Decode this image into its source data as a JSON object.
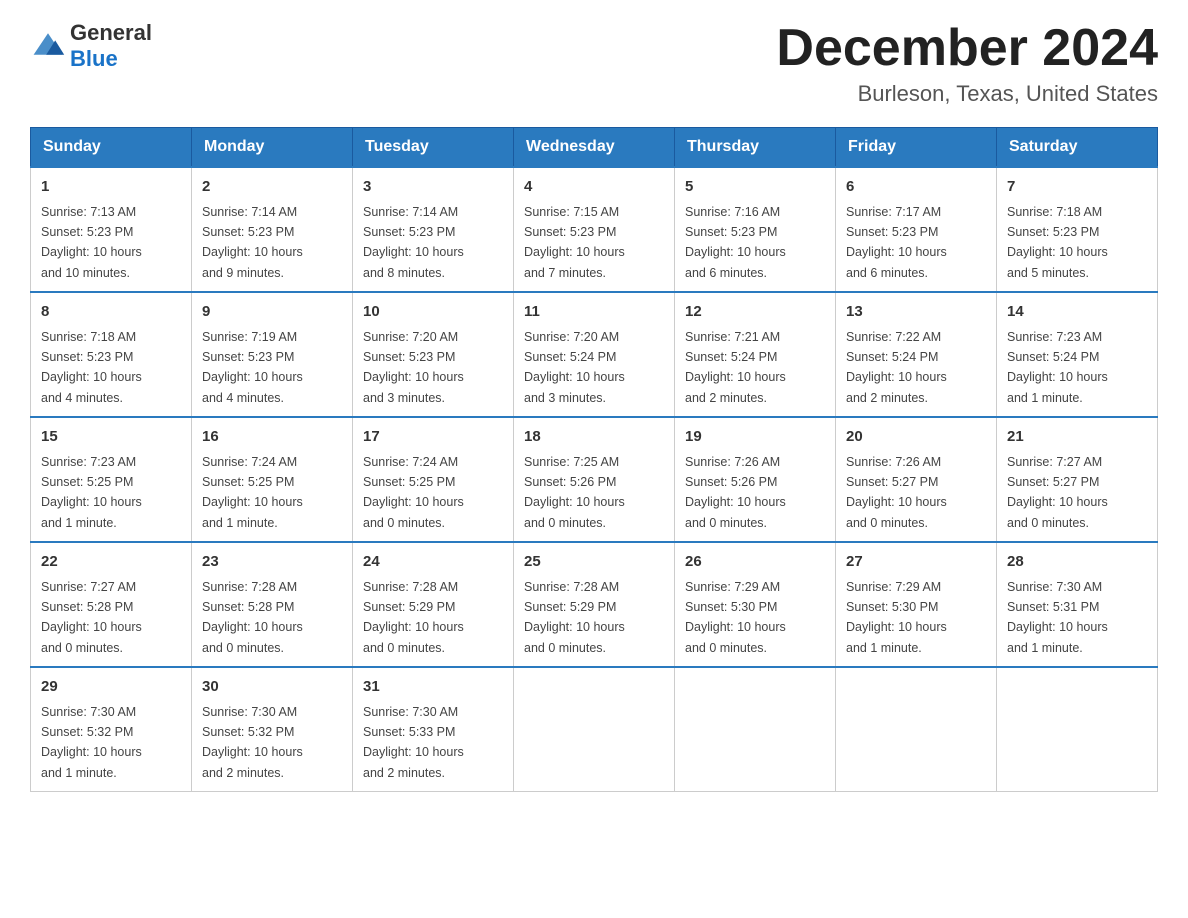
{
  "header": {
    "logo_general": "General",
    "logo_blue": "Blue",
    "month_title": "December 2024",
    "location": "Burleson, Texas, United States"
  },
  "days_of_week": [
    "Sunday",
    "Monday",
    "Tuesday",
    "Wednesday",
    "Thursday",
    "Friday",
    "Saturday"
  ],
  "weeks": [
    [
      {
        "day": "1",
        "sunrise": "7:13 AM",
        "sunset": "5:23 PM",
        "daylight": "10 hours and 10 minutes."
      },
      {
        "day": "2",
        "sunrise": "7:14 AM",
        "sunset": "5:23 PM",
        "daylight": "10 hours and 9 minutes."
      },
      {
        "day": "3",
        "sunrise": "7:14 AM",
        "sunset": "5:23 PM",
        "daylight": "10 hours and 8 minutes."
      },
      {
        "day": "4",
        "sunrise": "7:15 AM",
        "sunset": "5:23 PM",
        "daylight": "10 hours and 7 minutes."
      },
      {
        "day": "5",
        "sunrise": "7:16 AM",
        "sunset": "5:23 PM",
        "daylight": "10 hours and 6 minutes."
      },
      {
        "day": "6",
        "sunrise": "7:17 AM",
        "sunset": "5:23 PM",
        "daylight": "10 hours and 6 minutes."
      },
      {
        "day": "7",
        "sunrise": "7:18 AM",
        "sunset": "5:23 PM",
        "daylight": "10 hours and 5 minutes."
      }
    ],
    [
      {
        "day": "8",
        "sunrise": "7:18 AM",
        "sunset": "5:23 PM",
        "daylight": "10 hours and 4 minutes."
      },
      {
        "day": "9",
        "sunrise": "7:19 AM",
        "sunset": "5:23 PM",
        "daylight": "10 hours and 4 minutes."
      },
      {
        "day": "10",
        "sunrise": "7:20 AM",
        "sunset": "5:23 PM",
        "daylight": "10 hours and 3 minutes."
      },
      {
        "day": "11",
        "sunrise": "7:20 AM",
        "sunset": "5:24 PM",
        "daylight": "10 hours and 3 minutes."
      },
      {
        "day": "12",
        "sunrise": "7:21 AM",
        "sunset": "5:24 PM",
        "daylight": "10 hours and 2 minutes."
      },
      {
        "day": "13",
        "sunrise": "7:22 AM",
        "sunset": "5:24 PM",
        "daylight": "10 hours and 2 minutes."
      },
      {
        "day": "14",
        "sunrise": "7:23 AM",
        "sunset": "5:24 PM",
        "daylight": "10 hours and 1 minute."
      }
    ],
    [
      {
        "day": "15",
        "sunrise": "7:23 AM",
        "sunset": "5:25 PM",
        "daylight": "10 hours and 1 minute."
      },
      {
        "day": "16",
        "sunrise": "7:24 AM",
        "sunset": "5:25 PM",
        "daylight": "10 hours and 1 minute."
      },
      {
        "day": "17",
        "sunrise": "7:24 AM",
        "sunset": "5:25 PM",
        "daylight": "10 hours and 0 minutes."
      },
      {
        "day": "18",
        "sunrise": "7:25 AM",
        "sunset": "5:26 PM",
        "daylight": "10 hours and 0 minutes."
      },
      {
        "day": "19",
        "sunrise": "7:26 AM",
        "sunset": "5:26 PM",
        "daylight": "10 hours and 0 minutes."
      },
      {
        "day": "20",
        "sunrise": "7:26 AM",
        "sunset": "5:27 PM",
        "daylight": "10 hours and 0 minutes."
      },
      {
        "day": "21",
        "sunrise": "7:27 AM",
        "sunset": "5:27 PM",
        "daylight": "10 hours and 0 minutes."
      }
    ],
    [
      {
        "day": "22",
        "sunrise": "7:27 AM",
        "sunset": "5:28 PM",
        "daylight": "10 hours and 0 minutes."
      },
      {
        "day": "23",
        "sunrise": "7:28 AM",
        "sunset": "5:28 PM",
        "daylight": "10 hours and 0 minutes."
      },
      {
        "day": "24",
        "sunrise": "7:28 AM",
        "sunset": "5:29 PM",
        "daylight": "10 hours and 0 minutes."
      },
      {
        "day": "25",
        "sunrise": "7:28 AM",
        "sunset": "5:29 PM",
        "daylight": "10 hours and 0 minutes."
      },
      {
        "day": "26",
        "sunrise": "7:29 AM",
        "sunset": "5:30 PM",
        "daylight": "10 hours and 0 minutes."
      },
      {
        "day": "27",
        "sunrise": "7:29 AM",
        "sunset": "5:30 PM",
        "daylight": "10 hours and 1 minute."
      },
      {
        "day": "28",
        "sunrise": "7:30 AM",
        "sunset": "5:31 PM",
        "daylight": "10 hours and 1 minute."
      }
    ],
    [
      {
        "day": "29",
        "sunrise": "7:30 AM",
        "sunset": "5:32 PM",
        "daylight": "10 hours and 1 minute."
      },
      {
        "day": "30",
        "sunrise": "7:30 AM",
        "sunset": "5:32 PM",
        "daylight": "10 hours and 2 minutes."
      },
      {
        "day": "31",
        "sunrise": "7:30 AM",
        "sunset": "5:33 PM",
        "daylight": "10 hours and 2 minutes."
      },
      null,
      null,
      null,
      null
    ]
  ],
  "labels": {
    "sunrise": "Sunrise:",
    "sunset": "Sunset:",
    "daylight": "Daylight:"
  }
}
